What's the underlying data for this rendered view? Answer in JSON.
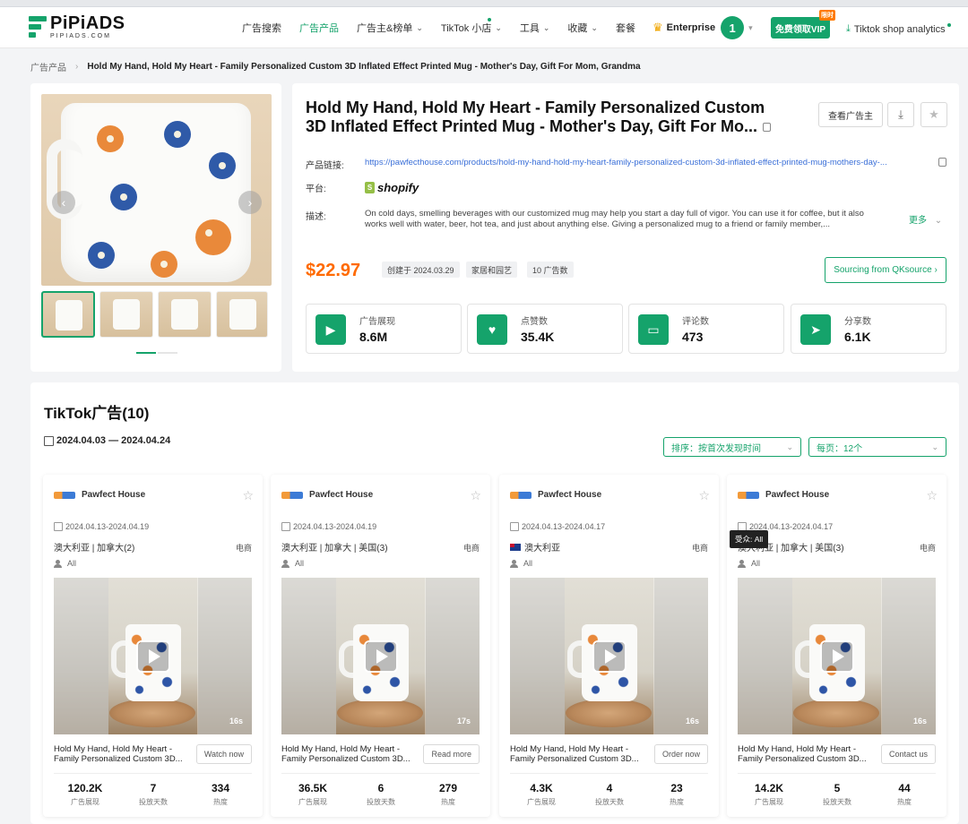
{
  "header": {
    "logo_text": "PiPiADS",
    "logo_sub": "PIPIADS.COM",
    "nav": [
      {
        "label": "广告搜索",
        "caret": false,
        "dot": false
      },
      {
        "label": "广告产品",
        "caret": false,
        "dot": false,
        "active": true
      },
      {
        "label": "广告主&榜单",
        "caret": true,
        "dot": false
      },
      {
        "label": "TikTok 小店",
        "caret": true,
        "dot": true
      },
      {
        "label": "工具",
        "caret": true,
        "dot": false
      },
      {
        "label": "收藏",
        "caret": true,
        "dot": false
      },
      {
        "label": "套餐",
        "caret": false,
        "dot": false
      }
    ],
    "enterprise_label": "Enterprise",
    "avatar_number": "1",
    "vip_button": "免费领取VIP",
    "vip_tag": "限时",
    "shop_analytics": "Tiktok shop analytics"
  },
  "breadcrumb": {
    "root": "广告产品",
    "current": "Hold My Hand, Hold My Heart - Family Personalized Custom 3D Inflated Effect Printed Mug - Mother's Day, Gift For Mom, Grandma"
  },
  "product": {
    "title": "Hold My Hand, Hold My Heart - Family Personalized Custom 3D Inflated Effect Printed Mug - Mother's Day, Gift For Mo...",
    "view_advertiser": "查看广告主",
    "link_label": "产品链接:",
    "link": "https://pawfecthouse.com/products/hold-my-hand-hold-my-heart-family-personalized-custom-3d-inflated-effect-printed-mug-mothers-day-...",
    "platform_label": "平台:",
    "platform": "shopify",
    "desc_label": "描述:",
    "description": "On cold days, smelling beverages with our customized mug may help you start a day full of vigor. You can use it for coffee, but it also works well with water, beer, hot tea, and just about anything else. Giving a personalized mug to a friend or family member,...",
    "more": "更多",
    "price": "$22.97",
    "created": "创建于 2024.03.29",
    "category": "家居和园艺",
    "ad_count": "10 广告数",
    "sourcing_button": "Sourcing from QKsource"
  },
  "stats": [
    {
      "label": "广告展现",
      "value": "8.6M",
      "icon": "play-icon"
    },
    {
      "label": "点赞数",
      "value": "35.4K",
      "icon": "heart-icon"
    },
    {
      "label": "评论数",
      "value": "473",
      "icon": "comment-icon"
    },
    {
      "label": "分享数",
      "value": "6.1K",
      "icon": "share-icon"
    }
  ],
  "ads": {
    "title": "TikTok广告(10)",
    "date_range": "2024.04.03 — 2024.04.24",
    "sort": "排序：按首次发现时间",
    "per_page": "每页：12个",
    "tooltip": "受众: All",
    "cards": [
      {
        "brand": "Pawfect House",
        "dates": "2024.04.13-2024.04.19",
        "regions": "澳大利亚 | 加拿大(2)",
        "flag": false,
        "category": "电商",
        "audience": "All",
        "duration": "16s",
        "title": "Hold My Hand, Hold My Heart - Family Personalized Custom 3D...",
        "cta": "Watch now",
        "impressions": "120.2K",
        "days": "7",
        "heat": "334"
      },
      {
        "brand": "Pawfect House",
        "dates": "2024.04.13-2024.04.19",
        "regions": "澳大利亚 | 加拿大 | 美国(3)",
        "flag": false,
        "category": "电商",
        "audience": "All",
        "duration": "17s",
        "title": "Hold My Hand, Hold My Heart - Family Personalized Custom 3D...",
        "cta": "Read more",
        "impressions": "36.5K",
        "days": "6",
        "heat": "279"
      },
      {
        "brand": "Pawfect House",
        "dates": "2024.04.13-2024.04.17",
        "regions": "澳大利亚",
        "flag": true,
        "category": "电商",
        "audience": "All",
        "duration": "16s",
        "title": "Hold My Hand, Hold My Heart - Family Personalized Custom 3D...",
        "cta": "Order now",
        "impressions": "4.3K",
        "days": "4",
        "heat": "23"
      },
      {
        "brand": "Pawfect House",
        "dates": "2024.04.13-2024.04.17",
        "regions": "澳大利亚 | 加拿大 | 美国(3)",
        "flag": false,
        "category": "电商",
        "audience": "All",
        "duration": "16s",
        "title": "Hold My Hand, Hold My Heart - Family Personalized Custom 3D...",
        "cta": "Contact us",
        "impressions": "14.2K",
        "days": "5",
        "heat": "44"
      }
    ],
    "metric_labels": {
      "impressions": "广告展现",
      "days": "投放天数",
      "heat": "热度"
    }
  },
  "colors": {
    "brand": "#15a36b",
    "price": "#ff6a00",
    "link": "#3a6fd8"
  }
}
